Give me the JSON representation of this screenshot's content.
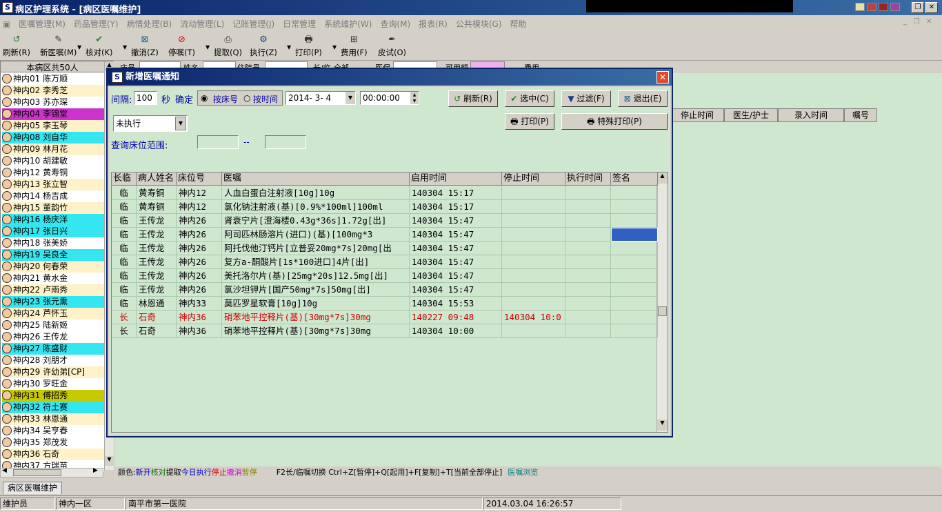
{
  "app": {
    "title": "病区护理系统 - [病区医嘱维护]"
  },
  "menu": [
    "医嘱管理(M)",
    "药品管理(Y)",
    "病情处理(B)",
    "流动管理(L)",
    "记账管理(J)",
    "日常管理",
    "系统维护(W)",
    "查询(M)",
    "报表(R)",
    "公共模块(G)",
    "帮助"
  ],
  "toolbar": [
    {
      "label": "刷新(R)",
      "icon": "refresh-icon"
    },
    {
      "label": "新医嘱(M)",
      "icon": "new-order-icon"
    },
    {
      "label": "核对(K)",
      "icon": "check-icon"
    },
    {
      "label": "撤消(Z)",
      "icon": "undo-icon"
    },
    {
      "label": "停嘱(T)",
      "icon": "stop-icon"
    },
    {
      "label": "提取(Q)",
      "icon": "extract-icon"
    },
    {
      "label": "执行(Z)",
      "icon": "execute-icon"
    },
    {
      "label": "打印(P)",
      "icon": "print-icon"
    },
    {
      "label": "费用(F)",
      "icon": "fee-icon"
    },
    {
      "label": "皮试(O)",
      "icon": "skin-test-icon"
    }
  ],
  "patients": {
    "header": "本病区共50人",
    "items": [
      {
        "label": "神内01  陈万顺",
        "bg": "#ffffff"
      },
      {
        "label": "神内02  李秀芝",
        "bg": "#fff2c8"
      },
      {
        "label": "神内03  苏亦琛",
        "bg": "#ffffff"
      },
      {
        "label": "神内04  李锦堂",
        "bg": "#cc33cc"
      },
      {
        "label": "神内05  李玉琴",
        "bg": "#fff2c8"
      },
      {
        "label": "神内08  刘自华",
        "bg": "#33e6f0"
      },
      {
        "label": "神内09  林月花",
        "bg": "#fff2c8"
      },
      {
        "label": "神内10  胡建敏",
        "bg": "#ffffff"
      },
      {
        "label": "神内12  黄寿铜",
        "bg": "#ffffff"
      },
      {
        "label": "神内13  张立智",
        "bg": "#fff2c8"
      },
      {
        "label": "神内14  杨吉成",
        "bg": "#ffffff"
      },
      {
        "label": "神内15  董韵竹",
        "bg": "#fff2c8"
      },
      {
        "label": "神内16  杨庆洋",
        "bg": "#33e6f0"
      },
      {
        "label": "神内17  张日兴",
        "bg": "#33e6f0"
      },
      {
        "label": "神内18  张美娇",
        "bg": "#ffffff"
      },
      {
        "label": "神内19  吴良全",
        "bg": "#33e6f0"
      },
      {
        "label": "神内20  何春荣",
        "bg": "#fff2c8"
      },
      {
        "label": "神内21  黄水金",
        "bg": "#ffffff"
      },
      {
        "label": "神内22  卢雨秀",
        "bg": "#fff2c8"
      },
      {
        "label": "神内23  张元熏",
        "bg": "#33e6f0"
      },
      {
        "label": "神内24  芦怀玉",
        "bg": "#fff2c8"
      },
      {
        "label": "神内25  陆新姬",
        "bg": "#ffffff"
      },
      {
        "label": "神内26  王传龙",
        "bg": "#ffffff"
      },
      {
        "label": "神内27  陈盛财",
        "bg": "#33e6f0"
      },
      {
        "label": "神内28  刘朋才",
        "bg": "#ffffff"
      },
      {
        "label": "神内29  许幼弟[CP]",
        "bg": "#fff2c8"
      },
      {
        "label": "神内30  罗旺金",
        "bg": "#ffffff"
      },
      {
        "label": "神内31  傅招秀",
        "bg": "#c8c800"
      },
      {
        "label": "神内32  符土赛",
        "bg": "#33e6f0"
      },
      {
        "label": "神内33  林恩通",
        "bg": "#fff2c8"
      },
      {
        "label": "神内34  吴亨春",
        "bg": "#ffffff"
      },
      {
        "label": "神内35  郑茂发",
        "bg": "#ffffff"
      },
      {
        "label": "神内36  石奇",
        "bg": "#fff2c8"
      },
      {
        "label": "神内37  方瑞苗",
        "bg": "#ffffff"
      }
    ]
  },
  "filter": {
    "labels": [
      "床号",
      "姓名",
      "住院号",
      "长/临",
      "全部",
      "医保",
      "可用额",
      "费用"
    ]
  },
  "bg_columns": [
    "停止时间",
    "医生/护士",
    "录入时间",
    "嘱号"
  ],
  "legend": {
    "prefix": "颜色:",
    "items": [
      {
        "t": "新开",
        "c": "#0000cc"
      },
      {
        "t": "核对",
        "c": "#008000"
      },
      {
        "t": "提取",
        "c": "#000000"
      },
      {
        "t": "今日执行",
        "c": "#0000cc"
      },
      {
        "t": "停止",
        "c": "#cc0000"
      },
      {
        "t": "撤消",
        "c": "#cc00cc"
      },
      {
        "t": "暂停",
        "c": "#808000"
      }
    ],
    "hint": "F2长/临嘱切换   Ctrl+Z[暂停]+Q[起用]+F[复制]+T[当前全部停止]",
    "browse": "医嘱浏览"
  },
  "tab_label": "病区医嘱维护",
  "status": {
    "user": "维护员",
    "ward": "神内一区",
    "hospital": "南平市第一医院",
    "datetime": "2014.03.04 16:26:57"
  },
  "dialog": {
    "title": "新增医嘱通知",
    "interval_label": "间隔:",
    "interval_value": "100",
    "sec": "秒",
    "confirm": "确定",
    "radio_bed": "按床号",
    "radio_time": "按时间",
    "date": "2014- 3- 4",
    "time": "00:00:00",
    "status_select": "未执行",
    "range_label": "查询床位范围:",
    "range_sep": "--",
    "buttons": {
      "refresh": "刷新(R)",
      "select": "选中(C)",
      "filter": "过滤(F)",
      "exit": "退出(E)",
      "print": "打印(P)",
      "special_print": "特殊打印(P)"
    },
    "columns": [
      "长临",
      "病人姓名",
      "床位号",
      "医嘱",
      "启用时间",
      "停止时间",
      "执行时间",
      "签名"
    ],
    "rows": [
      {
        "type": "临",
        "name": "黄寿铜",
        "bed": "神内12",
        "order": "人血白蛋白注射液[10g]10g",
        "start": "140304 15:17",
        "stop": "",
        "exec": "",
        "sign": "",
        "red": false
      },
      {
        "type": "临",
        "name": "黄寿铜",
        "bed": "神内12",
        "order": "氯化钠注射液(基)[0.9%*100ml]100ml",
        "start": "140304 15:17",
        "stop": "",
        "exec": "",
        "sign": "",
        "red": false
      },
      {
        "type": "临",
        "name": "王传龙",
        "bed": "神内26",
        "order": "肾衰宁片[澄海楼0.43g*36s]1.72g[出]",
        "start": "140304 15:47",
        "stop": "",
        "exec": "",
        "sign": "",
        "red": false
      },
      {
        "type": "临",
        "name": "王传龙",
        "bed": "神内26",
        "order": "阿司匹林肠溶片(进口)(基)[100mg*3",
        "start": "140304 15:47",
        "stop": "",
        "exec": "",
        "sign": "",
        "red": false
      },
      {
        "type": "临",
        "name": "王传龙",
        "bed": "神内26",
        "order": "阿托伐他汀钙片[立普妥20mg*7s]20mg[出",
        "start": "140304 15:47",
        "stop": "",
        "exec": "",
        "sign": "",
        "red": false
      },
      {
        "type": "临",
        "name": "王传龙",
        "bed": "神内26",
        "order": "复方a-酮酸片[1s*100进口]4片[出]",
        "start": "140304 15:47",
        "stop": "",
        "exec": "",
        "sign": "",
        "red": false
      },
      {
        "type": "临",
        "name": "王传龙",
        "bed": "神内26",
        "order": "美托洛尔片(基)[25mg*20s]12.5mg[出]",
        "start": "140304 15:47",
        "stop": "",
        "exec": "",
        "sign": "",
        "red": false
      },
      {
        "type": "临",
        "name": "王传龙",
        "bed": "神内26",
        "order": "氯沙坦钾片[国产50mg*7s]50mg[出]",
        "start": "140304 15:47",
        "stop": "",
        "exec": "",
        "sign": "",
        "red": false
      },
      {
        "type": "临",
        "name": "林恩通",
        "bed": "神内33",
        "order": "莫匹罗星软膏[10g]10g",
        "start": "140304 15:53",
        "stop": "",
        "exec": "",
        "sign": "",
        "red": false
      },
      {
        "type": "长",
        "name": "石奇",
        "bed": "神内36",
        "order": "硝苯地平控释片(基)[30mg*7s]30mg",
        "start": "140227 09:48",
        "stop": "140304 10:0",
        "exec": "",
        "sign": "",
        "red": true
      },
      {
        "type": "长",
        "name": "石奇",
        "bed": "神内36",
        "order": "硝苯地平控释片(基)[30mg*7s]30mg",
        "start": "140304 10:00",
        "stop": "",
        "exec": "",
        "sign": "",
        "red": false
      }
    ]
  }
}
